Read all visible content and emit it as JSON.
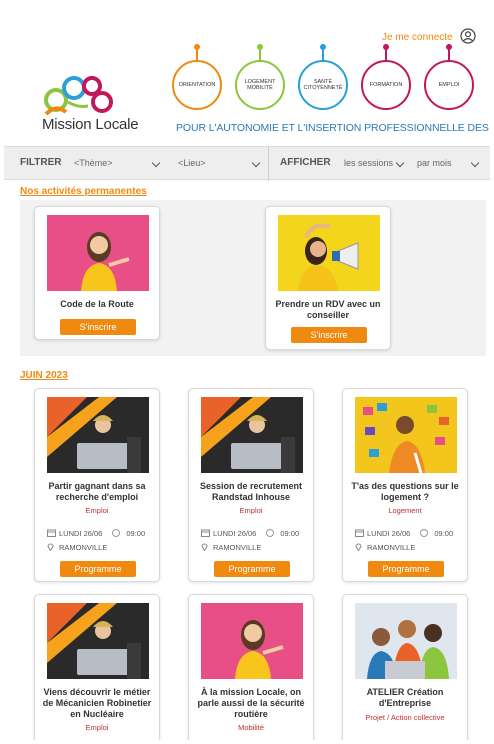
{
  "header": {
    "login_label": "Je me connecte",
    "logo_text": "Mission Locale",
    "tagline": "POUR L'AUTONOMIE ET L'INSERTION PROFESSIONNELLE DES JEUNES",
    "pillars": [
      {
        "label": "ORIENTATION",
        "color": "#f0890f"
      },
      {
        "label": "LOGEMENT MOBILITÉ",
        "color": "#8cc63f"
      },
      {
        "label": "SANTÉ CITOYENNETÉ",
        "color": "#2a9fd8"
      },
      {
        "label": "FORMATION",
        "color": "#c2185b"
      },
      {
        "label": "EMPLOI",
        "color": "#c2185b"
      }
    ]
  },
  "filter": {
    "filter_label": "FILTRER",
    "theme_placeholder": "<Thème>",
    "place_placeholder": "<Lieu>",
    "show_label": "AFFICHER",
    "sessions_value": "les sessions",
    "period_value": "par mois"
  },
  "permanent": {
    "title": "Nos activités permanentes",
    "cards": [
      {
        "title": "Code de la Route",
        "button": "S'inscrire"
      },
      {
        "title": "Prendre un RDV avec un conseiller",
        "button": "S'inscrire"
      }
    ]
  },
  "month": {
    "title": "JUIN 2023",
    "cards": [
      {
        "title": "Partir gagnant dans sa recherche d'emploi",
        "category": "Emploi",
        "date": "LUNDI 26/06",
        "time": "09:00",
        "place": "RAMONVILLE",
        "button": "Programme"
      },
      {
        "title": "Session de recrutement Randstad Inhouse",
        "category": "Emploi",
        "date": "LUNDI 26/06",
        "time": "09:00",
        "place": "RAMONVILLE",
        "button": "Programme"
      },
      {
        "title": "T'as des questions sur le logement ?",
        "category": "Logement",
        "date": "LUNDI 26/06",
        "time": "09:00",
        "place": "RAMONVILLE",
        "button": "Programme"
      },
      {
        "title": "Viens découvrir le métier de Mécanicien Robinetier en Nucléaire",
        "category": "Emploi"
      },
      {
        "title": "À la mission Locale, on parle aussi de la sécurité routière",
        "category": "Mobilité"
      },
      {
        "title": "ATELIER Création d'Entreprise",
        "category": "Projet / Action collective"
      }
    ]
  },
  "colors": {
    "accent": "#f0890f",
    "link_blue": "#2a7ab8",
    "category_red": "#c03030"
  }
}
